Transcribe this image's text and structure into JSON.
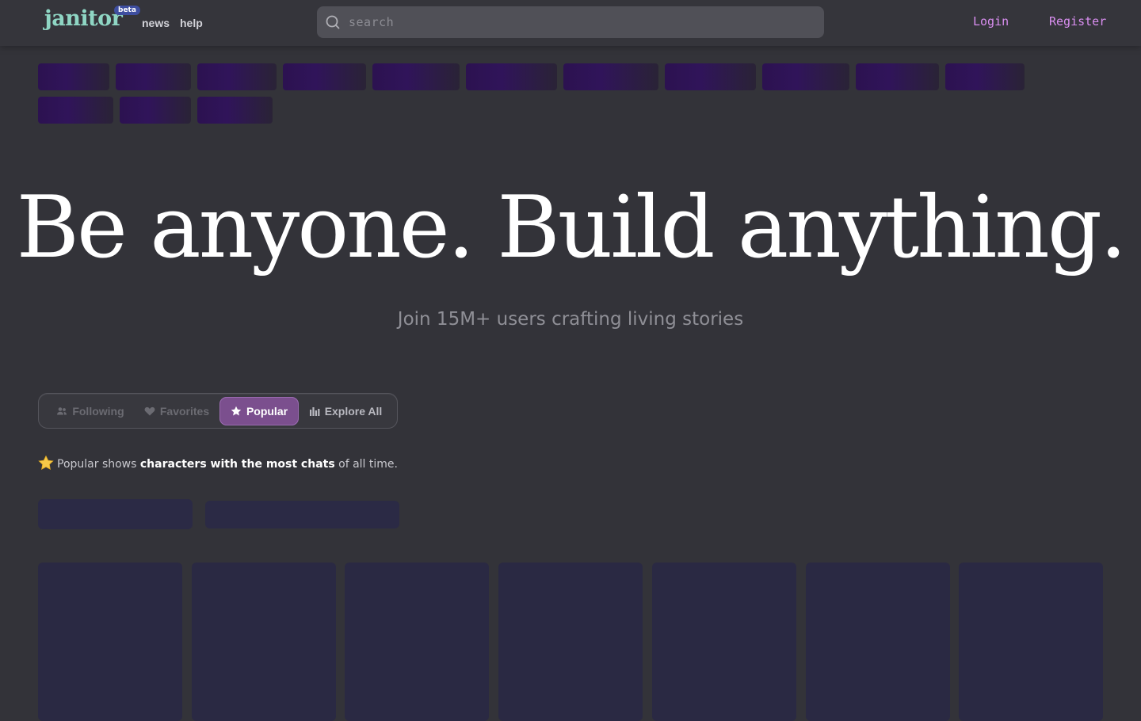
{
  "header": {
    "logo_text": "janitor",
    "logo_badge": "beta",
    "nav": [
      {
        "label": "news"
      },
      {
        "label": "help"
      }
    ],
    "search": {
      "placeholder": "search"
    },
    "login_label": "Login",
    "register_label": "Register"
  },
  "hero": {
    "title": "Be anyone. Build anything.",
    "subtitle": "Join 15M+ users crafting living stories"
  },
  "tabs": [
    {
      "label": "Following",
      "icon": "users-icon",
      "active": false
    },
    {
      "label": "Favorites",
      "icon": "heart-icon",
      "active": false
    },
    {
      "label": "Popular",
      "icon": "star-icon",
      "active": true
    },
    {
      "label": "Explore All",
      "icon": "bar-chart-icon",
      "active": false
    }
  ],
  "info": {
    "prefix": "Popular shows ",
    "highlight": "characters with the most chats",
    "suffix": " of all time."
  },
  "colors": {
    "accent": "#d98ef0",
    "active_tab": "#7b4f8e",
    "logo": "#8fd6c4",
    "background": "#333339"
  }
}
